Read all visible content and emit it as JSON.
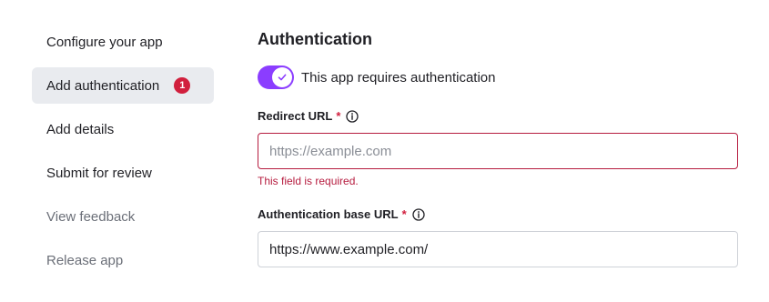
{
  "sidebar": {
    "items": [
      {
        "label": "Configure your app"
      },
      {
        "label": "Add authentication",
        "badge": "1"
      },
      {
        "label": "Add details"
      },
      {
        "label": "Submit for review"
      },
      {
        "label": "View feedback"
      },
      {
        "label": "Release app"
      }
    ]
  },
  "main": {
    "title": "Authentication",
    "toggle": {
      "label": "This app requires authentication",
      "on": true
    },
    "redirect_url": {
      "label": "Redirect URL",
      "required_marker": "*",
      "placeholder": "https://example.com",
      "value": "",
      "error": "This field is required."
    },
    "auth_base_url": {
      "label": "Authentication base URL",
      "required_marker": "*",
      "placeholder": "",
      "value": "https://www.example.com/"
    }
  },
  "colors": {
    "accent": "#8b3dff",
    "error": "#b61c3f",
    "badge": "#d11f3d",
    "active_nav_bg": "#e9ebef"
  }
}
